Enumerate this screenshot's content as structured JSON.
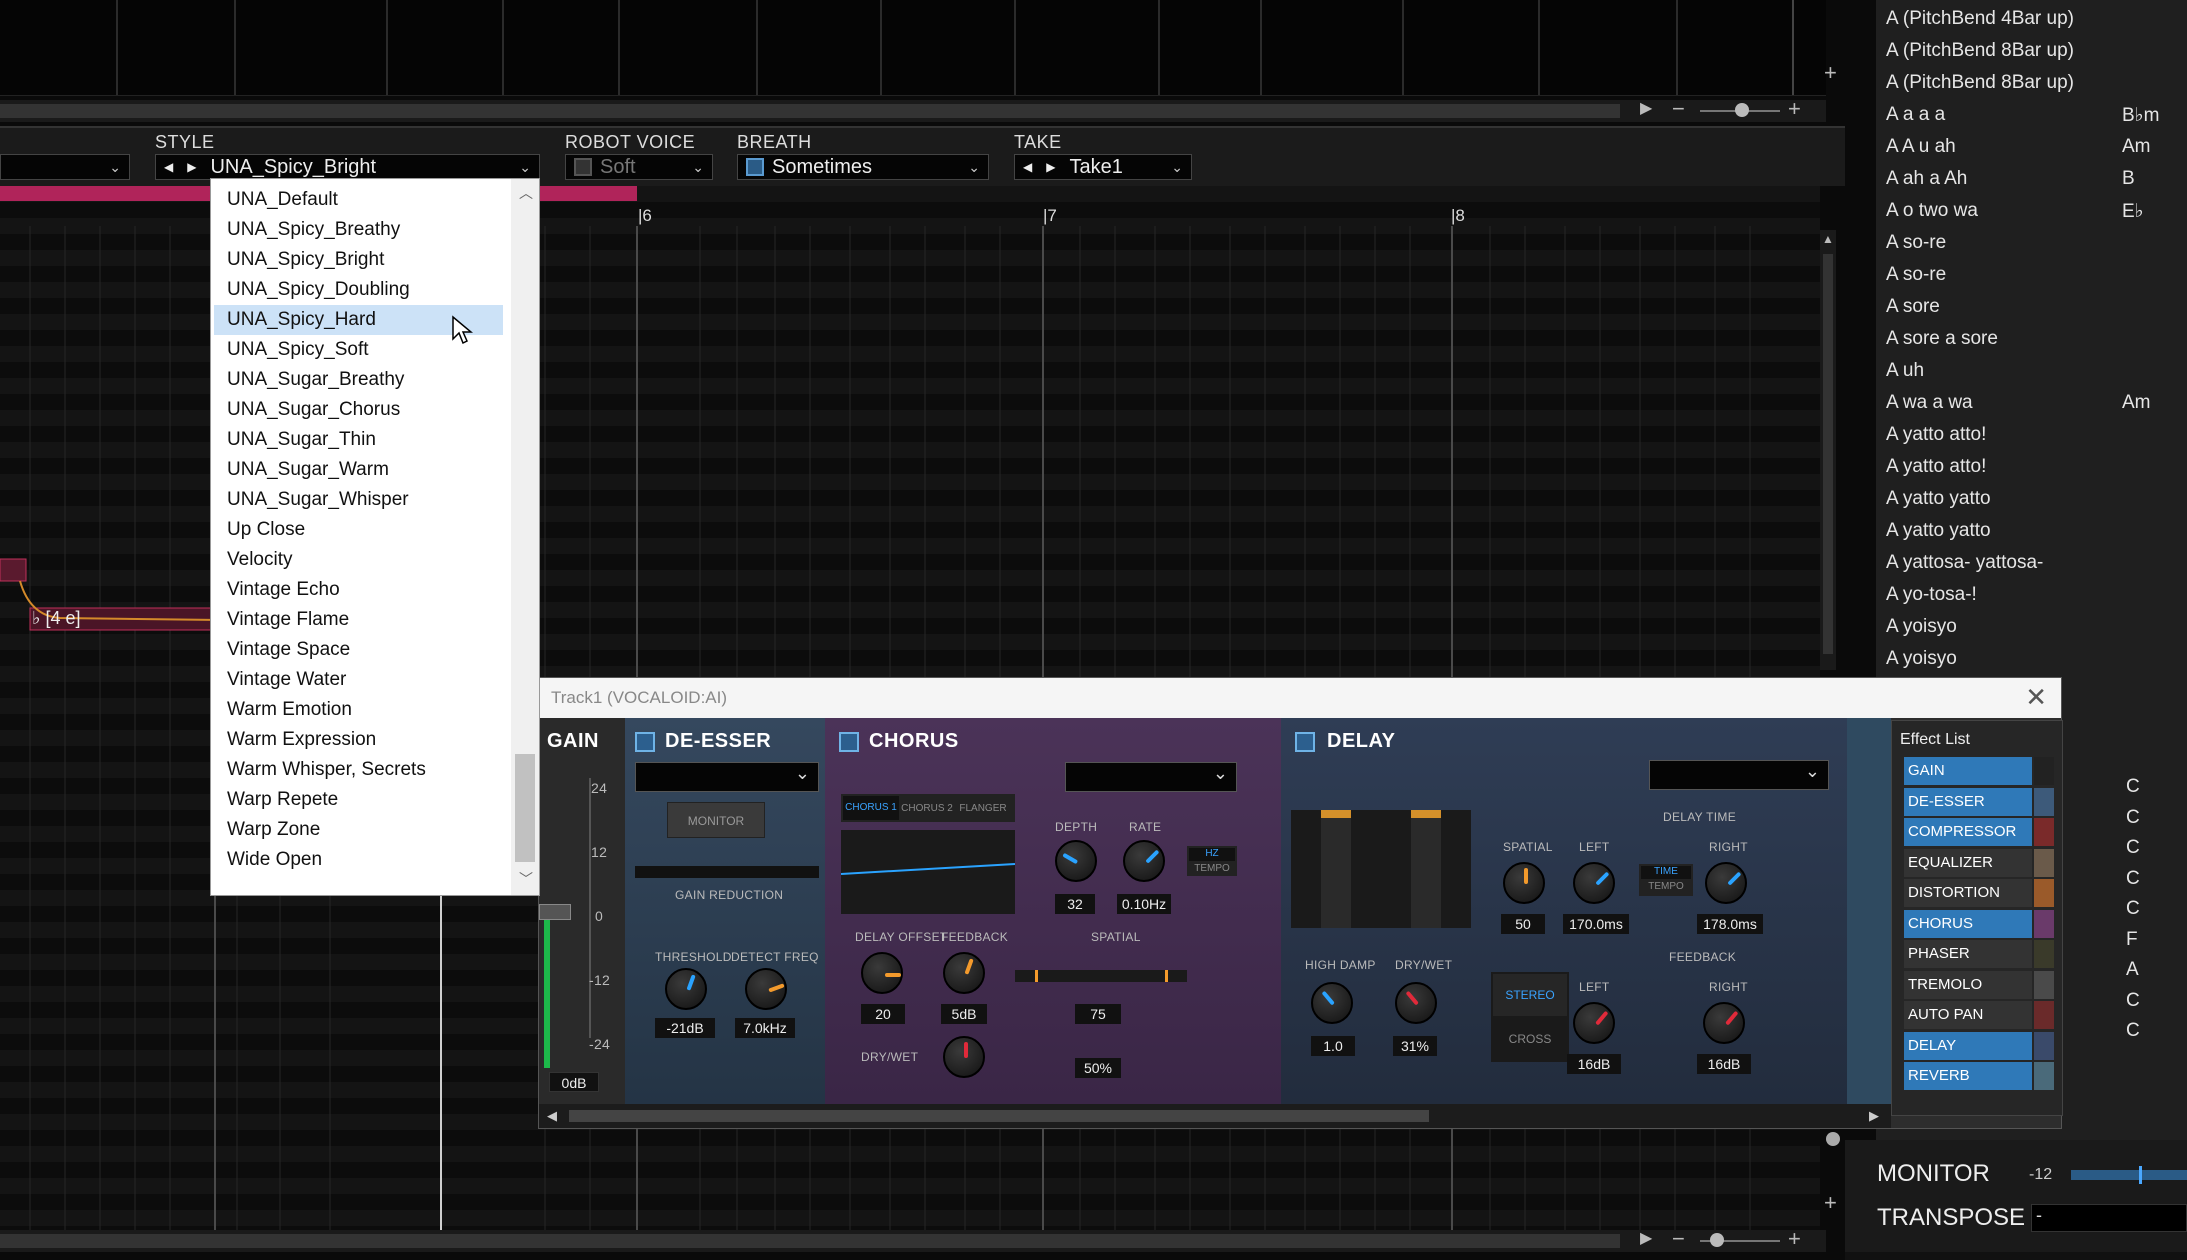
{
  "style_bar": {
    "style_label": "STYLE",
    "style_value": "UNA_Spicy_Bright",
    "robot_label": "ROBOT VOICE",
    "robot_value": "Soft",
    "breath_label": "BREATH",
    "breath_value": "Sometimes",
    "take_label": "TAKE",
    "take_value": "Take1"
  },
  "ruler": {
    "m6": "6",
    "m7": "7",
    "m8": "8"
  },
  "note_label": "♭ [4 e]",
  "dropdown_items": [
    "UNA_Default",
    "UNA_Spicy_Breathy",
    "UNA_Spicy_Bright",
    "UNA_Spicy_Doubling",
    "UNA_Spicy_Hard",
    "UNA_Spicy_Soft",
    "UNA_Sugar_Breathy",
    "UNA_Sugar_Chorus",
    "UNA_Sugar_Thin",
    "UNA_Sugar_Warm",
    "UNA_Sugar_Whisper",
    "Up Close",
    "Velocity",
    "Vintage Echo",
    "Vintage Flame",
    "Vintage Space",
    "Vintage Water",
    "Warm Emotion",
    "Warm Expression",
    "Warm Whisper, Secrets",
    "Warp Repete",
    "Warp Zone",
    "Wide Open"
  ],
  "dropdown_selected": "UNA_Spicy_Hard",
  "phrase_list": [
    {
      "name": "A (PitchBend 4Bar up)",
      "chord": ""
    },
    {
      "name": "A (PitchBend 8Bar up)",
      "chord": ""
    },
    {
      "name": "A (PitchBend 8Bar up)",
      "chord": ""
    },
    {
      "name": "A a a a",
      "chord": "B♭m"
    },
    {
      "name": "A A u ah",
      "chord": "Am"
    },
    {
      "name": "A ah a Ah",
      "chord": "B"
    },
    {
      "name": "A o two wa",
      "chord": "E♭"
    },
    {
      "name": "A so-re",
      "chord": ""
    },
    {
      "name": "A so-re",
      "chord": ""
    },
    {
      "name": "A sore",
      "chord": ""
    },
    {
      "name": "A sore a sore",
      "chord": ""
    },
    {
      "name": "A uh",
      "chord": ""
    },
    {
      "name": "A wa a wa",
      "chord": "Am"
    },
    {
      "name": "A yatto atto!",
      "chord": ""
    },
    {
      "name": "A yatto atto!",
      "chord": ""
    },
    {
      "name": "A yatto yatto",
      "chord": ""
    },
    {
      "name": "A yatto yatto",
      "chord": ""
    },
    {
      "name": "A yattosa- yattosa-",
      "chord": ""
    },
    {
      "name": "A yo-tosa-!",
      "chord": ""
    },
    {
      "name": "A yoisyo",
      "chord": ""
    },
    {
      "name": "A yoisyo",
      "chord": ""
    }
  ],
  "phrase_chords_lower": [
    "C",
    "C",
    "C",
    "C",
    "C",
    "F",
    "A",
    "C",
    "C"
  ],
  "plugin": {
    "title": "Track1 (VOCALOID:AI)",
    "gain": {
      "title": "GAIN",
      "scale": [
        "24",
        "12",
        "0",
        "-12",
        "-24"
      ],
      "value": "0dB"
    },
    "deesser": {
      "title": "DE-ESSER",
      "monitor": "MONITOR",
      "gain_reduction": "GAIN REDUCTION",
      "threshold_label": "THRESHOLD",
      "threshold": "-21dB",
      "detect_label": "DETECT FREQ",
      "detect": "7.0kHz"
    },
    "chorus": {
      "title": "CHORUS",
      "tabs": [
        "CHORUS 1",
        "CHORUS 2",
        "FLANGER"
      ],
      "depth_label": "DEPTH",
      "depth": "32",
      "rate_label": "RATE",
      "rate": "0.10Hz",
      "hz": "HZ",
      "tempo": "TEMPO",
      "offset_label": "DELAY OFFSET",
      "offset": "20",
      "feedback_label": "FEEDBACK",
      "feedback": "5dB",
      "spatial_label": "SPATIAL",
      "spatial": "75",
      "drywet_label": "DRY/WET",
      "drywet": "50%"
    },
    "delay": {
      "title": "DELAY",
      "spatial_label": "SPATIAL",
      "spatial": "50",
      "delay_time": "DELAY TIME",
      "left": "LEFT",
      "right": "RIGHT",
      "left_ms": "170.0ms",
      "right_ms": "178.0ms",
      "time": "TIME",
      "tempo": "TEMPO",
      "highdamp_label": "HIGH DAMP",
      "highdamp": "1.0",
      "drywet_label": "DRY/WET",
      "drywet": "31%",
      "stereo": "STEREO",
      "cross": "CROSS",
      "feedback": "FEEDBACK",
      "fb_left": "16dB",
      "fb_right": "16dB"
    },
    "effect_list_title": "Effect List",
    "effects": [
      {
        "name": "GAIN",
        "on": true,
        "color": "#222"
      },
      {
        "name": "DE-ESSER",
        "on": true,
        "color": "#3d5a7a"
      },
      {
        "name": "COMPRESSOR",
        "on": true,
        "color": "#7a2a2a"
      },
      {
        "name": "EQUALIZER",
        "on": false,
        "color": "#6a5a4a"
      },
      {
        "name": "DISTORTION",
        "on": false,
        "color": "#9a5a2a"
      },
      {
        "name": "CHORUS",
        "on": true,
        "color": "#6a3a6a"
      },
      {
        "name": "PHASER",
        "on": false,
        "color": "#3a3a2a"
      },
      {
        "name": "TREMOLO",
        "on": false,
        "color": "#4a4a4a"
      },
      {
        "name": "AUTO PAN",
        "on": false,
        "color": "#6a2a2a"
      },
      {
        "name": "DELAY",
        "on": true,
        "color": "#3a4a6a"
      },
      {
        "name": "REVERB",
        "on": true,
        "color": "#4a6a7a"
      }
    ]
  },
  "monitor": {
    "label": "MONITOR",
    "value": "-12"
  },
  "transpose": {
    "label": "TRANSPOSE",
    "value": "-"
  },
  "zoom": {
    "minus": "−",
    "plus": "+"
  }
}
